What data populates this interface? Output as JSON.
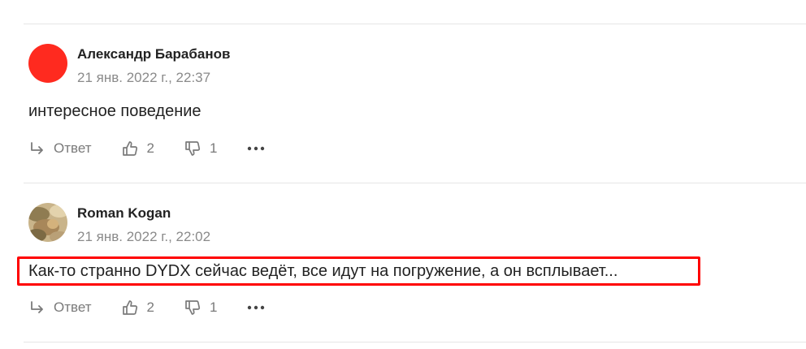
{
  "comments": [
    {
      "author": "Александр Барабанов",
      "date": "21 янв. 2022 г., 22:37",
      "text": "интересное поведение",
      "reply_label": "Ответ",
      "likes": "2",
      "dislikes": "1",
      "avatar_color": "#ff2a1f"
    },
    {
      "author": "Roman Kogan",
      "date": "21 янв. 2022 г., 22:02",
      "text": "Как-то странно DYDX сейчас ведёт, все идут на погружение, а он всплывает...",
      "reply_label": "Ответ",
      "likes": "2",
      "dislikes": "1"
    }
  ],
  "highlight_color": "#ff0000"
}
